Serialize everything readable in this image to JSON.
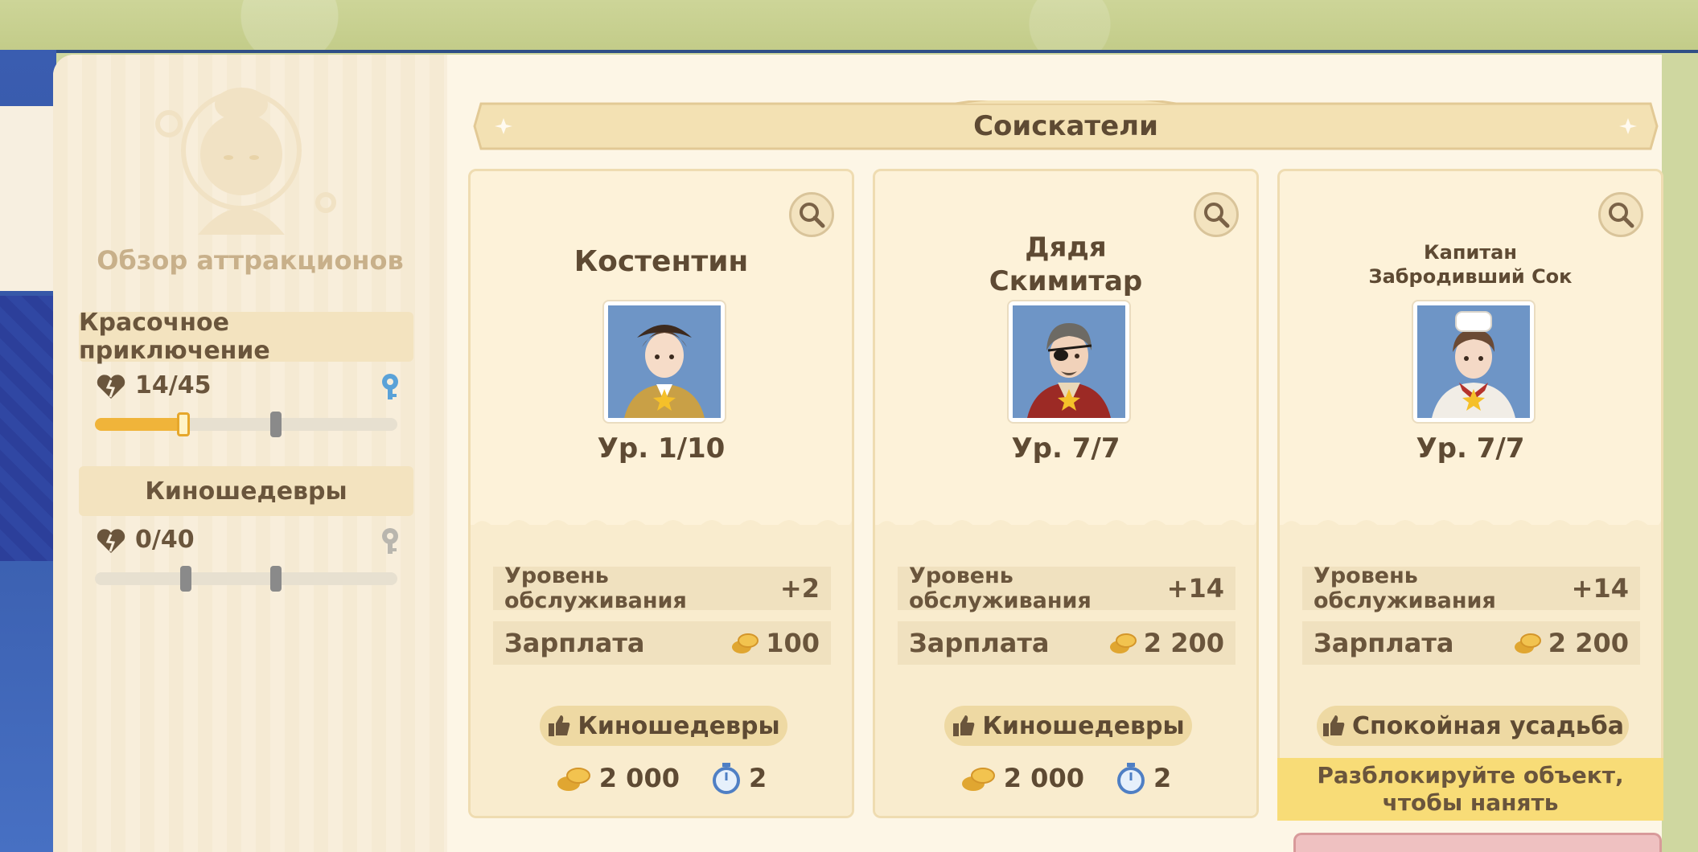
{
  "sidebar": {
    "title": "Обзор аттракционов",
    "attractions": [
      {
        "name": "Красочное приключение",
        "count": "14/45",
        "progress": 0.29,
        "unlocked": true
      },
      {
        "name": "Киношедевры",
        "count": "0/40",
        "progress": 0,
        "unlocked": false
      }
    ]
  },
  "main": {
    "title": "Соискатели",
    "candidates": [
      {
        "name": "Костентин",
        "level": "Ур. 1/10",
        "service_label": "Уровень обслуживания",
        "service_value": "+2",
        "salary_label": "Зарплата",
        "salary_value": "100",
        "preference": "Киношедевры",
        "hire_cost": "2 000",
        "hire_time": "2"
      },
      {
        "name": "Дядя Скимитар",
        "level": "Ур. 7/7",
        "service_label": "Уровень обслуживания",
        "service_value": "+14",
        "salary_label": "Зарплата",
        "salary_value": "2 200",
        "preference": "Киношедевры",
        "hire_cost": "2 000",
        "hire_time": "2"
      },
      {
        "name": "Капитан Забродивший Сок",
        "level": "Ур. 7/7",
        "service_label": "Уровень обслуживания",
        "service_value": "+14",
        "salary_label": "Зарплата",
        "salary_value": "2 200",
        "preference": "Спокойная усадьба",
        "locked_message": "Разблокируйте объект, чтобы нанять"
      }
    ]
  },
  "colors": {
    "accent": "#f0b43a",
    "text": "#5e4a33",
    "panel": "#fdf6e6",
    "locked_banner": "#f8dc77"
  },
  "icons": [
    "heart-broken-icon",
    "key-icon",
    "search-icon",
    "coin-icon",
    "thumbs-up-icon",
    "stopwatch-icon",
    "star-icon"
  ]
}
